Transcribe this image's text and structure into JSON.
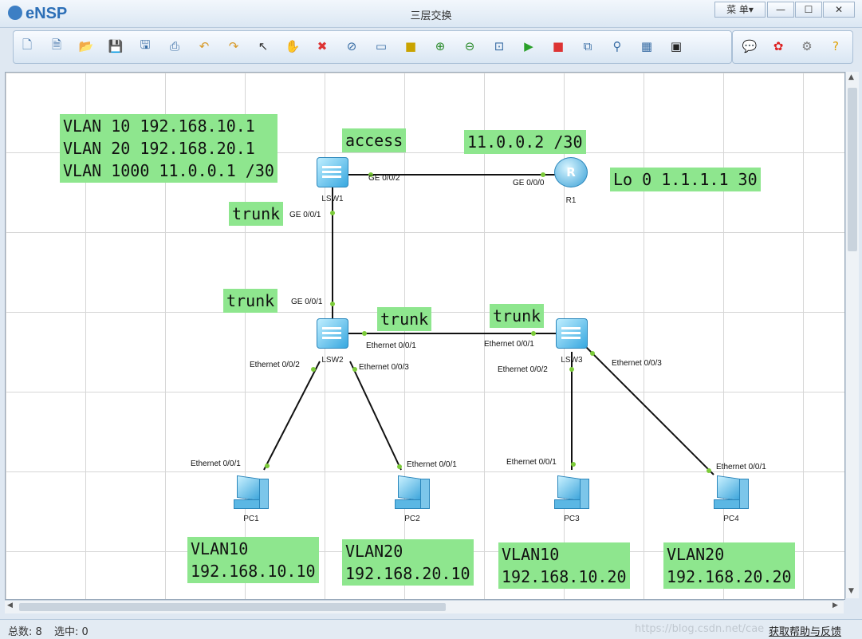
{
  "app": {
    "name": "eNSP",
    "window_title": "三层交换",
    "menu_label": "菜 单▾"
  },
  "window_controls": {
    "minimize": "—",
    "maximize": "☐",
    "close": "✕"
  },
  "toolbar": {
    "left_icons": [
      "new-topology-icon",
      "new-workspace-icon",
      "open-icon",
      "save-icon",
      "save-as-icon",
      "print-icon",
      "undo-icon",
      "redo-icon",
      "select-icon",
      "pan-hand-icon",
      "delete-icon",
      "delete-link-icon",
      "text-label-icon",
      "rectangle-icon",
      "zoom-in-icon",
      "zoom-out-icon",
      "fit-view-icon",
      "start-device-icon",
      "stop-device-icon",
      "capture-icon",
      "topology-icon",
      "table-icon",
      "console-icon"
    ],
    "right_icons": [
      "message-icon",
      "huawei-icon",
      "settings-icon",
      "help-icon"
    ]
  },
  "devices": {
    "lsw1": "LSW1",
    "r1": "R1",
    "lsw2": "LSW2",
    "lsw3": "LSW3",
    "pc1": "PC1",
    "pc2": "PC2",
    "pc3": "PC3",
    "pc4": "PC4"
  },
  "ports": {
    "lsw1_ge002": "GE 0/0/2",
    "r1_ge000": "GE 0/0/0",
    "lsw1_ge001": "GE 0/0/1",
    "lsw2_ge001": "GE 0/0/1",
    "lsw2_eth001": "Ethernet 0/0/1",
    "lsw3_eth001": "Ethernet 0/0/1",
    "lsw2_eth002": "Ethernet 0/0/2",
    "lsw2_eth003": "Ethernet 0/0/3",
    "lsw3_eth002": "Ethernet 0/0/2",
    "lsw3_eth003": "Ethernet 0/0/3",
    "pc1_eth001": "Ethernet 0/0/1",
    "pc2_eth001": "Ethernet 0/0/1",
    "pc3_eth001": "Ethernet 0/0/1",
    "pc4_eth001": "Ethernet 0/0/1"
  },
  "annotations": {
    "vlan_info": "VLAN 10 192.168.10.1\nVLAN 20 192.168.20.1\nVLAN 1000 11.0.0.1 /30",
    "access": "access",
    "r1_ip": "11.0.0.2 /30",
    "loopback": "Lo 0 1.1.1.1 30",
    "trunk_lsw1": "trunk",
    "trunk_lsw2_up": "trunk",
    "trunk_lsw2_right": "trunk",
    "trunk_lsw3": "trunk",
    "pc1_info": "VLAN10\n192.168.10.10",
    "pc2_info": "VLAN20\n192.168.20.10",
    "pc3_info": "VLAN10\n192.168.10.20",
    "pc4_info": "VLAN20\n192.168.20.20"
  },
  "status": {
    "total": "总数: 8",
    "selected": "选中: 0",
    "watermark": "https://blog.csdn.net/cae",
    "help_link": "获取帮助与反馈"
  },
  "colors": {
    "label_bg": "#8ee68e",
    "link": "#111111",
    "port_dot": "#7ccb3a"
  }
}
